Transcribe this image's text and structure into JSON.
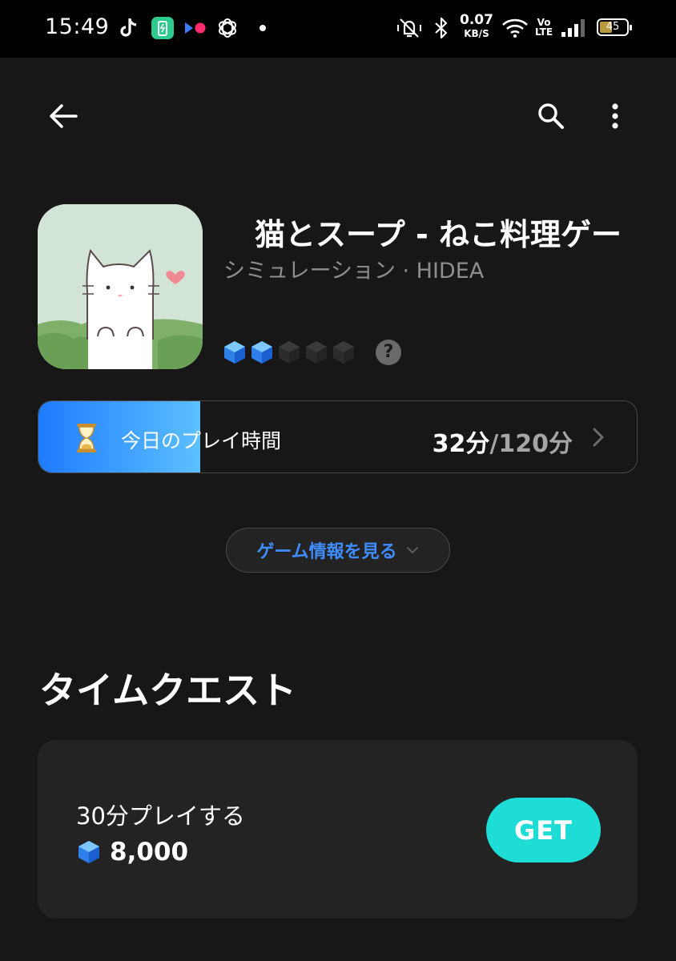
{
  "status_bar": {
    "time": "15:49",
    "speed_value": "0.07",
    "speed_unit": "KB/S",
    "volte_top": "Vo",
    "volte_bottom": "LTE",
    "battery": "45",
    "battery_level": 0.45
  },
  "app": {
    "title": "猫とスープ - ねこ料理ゲー",
    "subtitle": "シミュレーション · HIDEA",
    "gem_rating": {
      "filled": 2,
      "total": 5
    },
    "help_symbol": "?"
  },
  "play_time": {
    "label": "今日のプレイ時間",
    "current": "32分",
    "separator": "/",
    "total": "120分",
    "progress": 0.27
  },
  "game_info_button": "ゲーム情報を見る",
  "section": {
    "title": "タイムクエスト"
  },
  "quest": {
    "name": "30分プレイする",
    "reward": "8,000",
    "button": "GET"
  },
  "colors": {
    "accent_blue": "#1f7bff",
    "link_blue": "#3f8cff",
    "get_button": "#1edcd6",
    "background": "#171717",
    "card": "#232323"
  }
}
